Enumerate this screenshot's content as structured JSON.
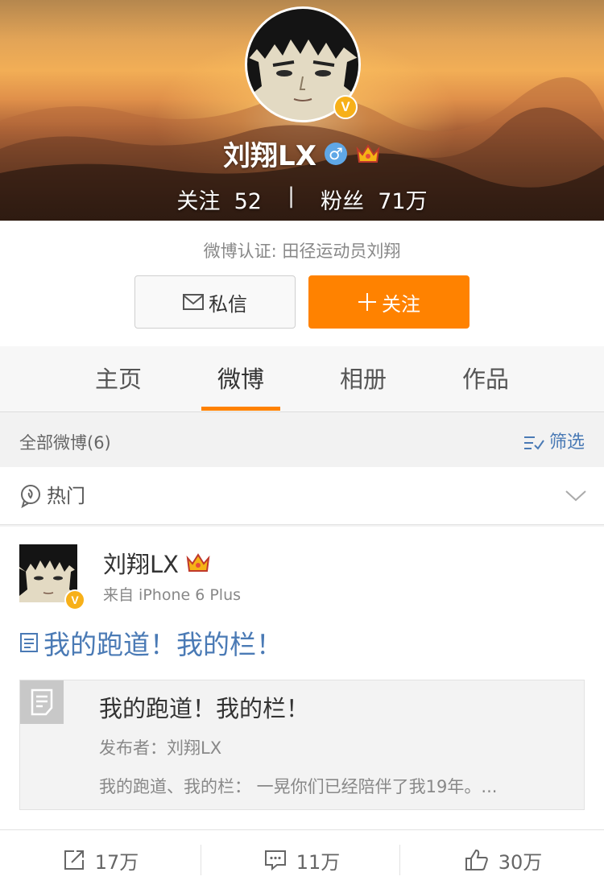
{
  "profile": {
    "name": "刘翔LX",
    "gender_symbol": "♂",
    "verified_badge": "V",
    "following_label": "关注",
    "following_count": "52",
    "stat_separator": "|",
    "followers_label": "粉丝",
    "followers_count": "71万",
    "verification": "微博认证: 田径运动员刘翔"
  },
  "buttons": {
    "message_label": "私信",
    "follow_label": "关注",
    "follow_plus": "+"
  },
  "tabs": [
    {
      "label": "主页",
      "active": false
    },
    {
      "label": "微博",
      "active": true
    },
    {
      "label": "相册",
      "active": false
    },
    {
      "label": "作品",
      "active": false
    }
  ],
  "filter": {
    "title": "全部微博(6)",
    "filter_label": "筛选"
  },
  "hot": {
    "label": "热门"
  },
  "post": {
    "author": "刘翔LX",
    "source": "来自 iPhone 6 Plus",
    "text": "我的跑道！我的栏！",
    "card": {
      "title": "我的跑道！我的栏！",
      "author": "发布者：刘翔LX",
      "summary": "我的跑道、我的栏： 一晃你们已经陪伴了我19年。..."
    },
    "actions": {
      "repost_count": "17万",
      "comment_count": "11万",
      "like_count": "30万"
    }
  },
  "colors": {
    "accent_orange": "#ff8200",
    "link_blue": "#4a7ab5",
    "badge_gold": "#f7b019",
    "gender_blue": "#5fa7e6"
  },
  "icons": {
    "message": "mail-icon",
    "follow": "plus-icon",
    "filter": "filter-list-icon",
    "hot": "hot-location-icon",
    "expand": "chevron-down-icon",
    "article": "article-icon",
    "card": "document-icon",
    "repost": "repost-icon",
    "comment": "comment-icon",
    "like": "thumbs-up-icon",
    "membership": "crown-icon"
  }
}
